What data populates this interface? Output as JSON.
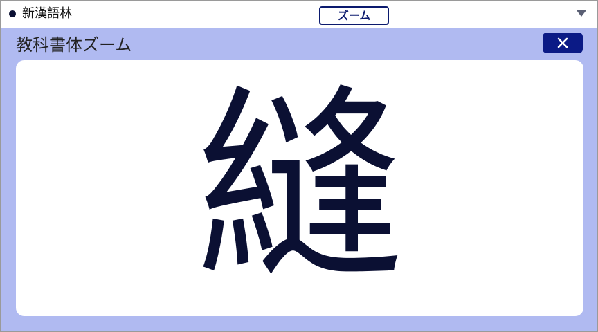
{
  "header": {
    "dictionary_name": "新漢語林",
    "mode_label": "ズーム"
  },
  "panel": {
    "title": "教科書体ズーム",
    "close_label": "✕"
  },
  "zoom": {
    "character": "縫"
  },
  "colors": {
    "accent": "#0b1a86",
    "panel_bg": "#b0baf1",
    "glyph": "#0b1033"
  }
}
